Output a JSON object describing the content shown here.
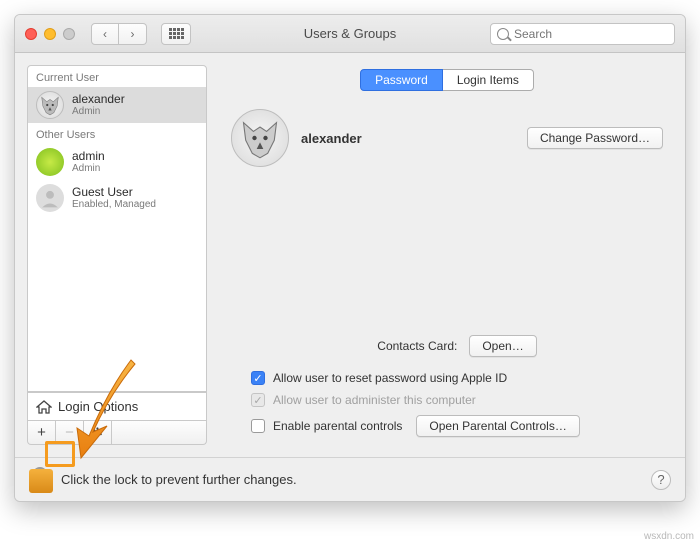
{
  "window": {
    "title": "Users & Groups",
    "search_placeholder": "Search"
  },
  "sidebar": {
    "current_user_label": "Current User",
    "other_users_label": "Other Users",
    "users": [
      {
        "name": "alexander",
        "role": "Admin",
        "avatar": "fox",
        "selected": true
      },
      {
        "name": "admin",
        "role": "Admin",
        "avatar": "green",
        "selected": false
      },
      {
        "name": "Guest User",
        "role": "Enabled, Managed",
        "avatar": "gray",
        "selected": false
      }
    ],
    "login_options": "Login Options",
    "add": "+",
    "remove": "−"
  },
  "tabs": {
    "password": "Password",
    "login_items": "Login Items"
  },
  "profile": {
    "name": "alexander",
    "change_password": "Change Password…"
  },
  "options": {
    "contacts_label": "Contacts Card:",
    "open": "Open…",
    "allow_reset": "Allow user to reset password using Apple ID",
    "allow_admin": "Allow user to administer this computer",
    "enable_parental": "Enable parental controls",
    "open_parental": "Open Parental Controls…"
  },
  "footer": {
    "lock_text": "Click the lock to prevent further changes.",
    "help": "?"
  },
  "watermark": "wsxdn.com"
}
